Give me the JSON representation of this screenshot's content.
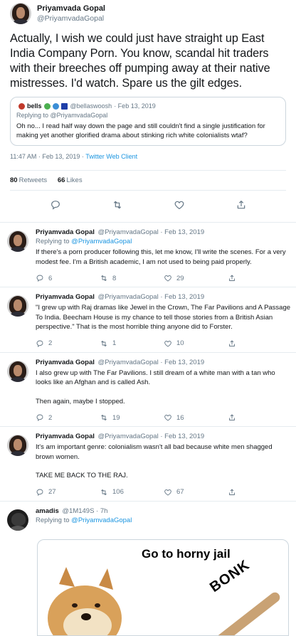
{
  "main_tweet": {
    "display_name": "Priyamvada Gopal",
    "handle": "@PriyamvadaGopal",
    "text": "Actually, I wish we could just have straight up East India Company Porn. You know, scandal hit traders with their breeches off pumping away at their native mistresses. I'd watch. Spare us the gilt edges.",
    "quote": {
      "name": "bells",
      "handle": "@bellaswoosh",
      "date": "· Feb 13, 2019",
      "replying_prefix": "Replying to",
      "replying_to": "@PriyamvadaGopal",
      "text": "Oh no... I read half way down the page and still couldn't find a single justification for making yet another glorified drama about stinking rich white colonialists wtaf?"
    },
    "timestamp": "11:47 AM · Feb 13, 2019 · ",
    "client": "Twitter Web Client",
    "retweets_count": "80",
    "retweets_label": "Retweets",
    "likes_count": "66",
    "likes_label": "Likes"
  },
  "replies": [
    {
      "name": "Priyamvada Gopal",
      "handle": "@PriyamvadaGopal · Feb 13, 2019",
      "replying_prefix": "Replying to",
      "replying_to": "@PriyamvadaGopal",
      "text": "If there's a porn producer following this, let me know, I'll write the scenes. For a very modest fee. I'm a British academic, I am not used to being paid properly.",
      "replies": "6",
      "retweets": "8",
      "likes": "29"
    },
    {
      "name": "Priyamvada Gopal",
      "handle": "@PriyamvadaGopal · Feb 13, 2019",
      "text": "\"I grew up with Raj dramas like Jewel in the Crown, The Far Pavilions and A Passage To India. Beecham House is my chance to tell those stories from a British Asian perspective.\" That is the most horrible thing anyone did to Forster.",
      "replies": "2",
      "retweets": "1",
      "likes": "10"
    },
    {
      "name": "Priyamvada Gopal",
      "handle": "@PriyamvadaGopal · Feb 13, 2019",
      "text": "I also grew up with The Far Pavilions. I still dream of a white man with a tan who looks like an Afghan and is called Ash.",
      "text2": "Then again, maybe I stopped.",
      "replies": "2",
      "retweets": "19",
      "likes": "16"
    },
    {
      "name": "Priyamvada Gopal",
      "handle": "@PriyamvadaGopal · Feb 13, 2019",
      "text": "It's am important genre: colonialism wasn't all bad because white men shagged brown women.",
      "text2": "TAKE ME BACK TO THE RAJ.",
      "replies": "27",
      "retweets": "106",
      "likes": "67"
    },
    {
      "name": "amadis",
      "handle": "@1M149S · 7h",
      "replying_prefix": "Replying to",
      "replying_to": "@PriyamvadaGopal",
      "meme_caption": "Go to horny jail",
      "meme_text": "BONK"
    }
  ],
  "colors": {
    "link": "#1b95e0",
    "muted": "#657786",
    "divider": "#e6ecf0"
  },
  "icons": [
    "reply-icon",
    "retweet-icon",
    "like-icon",
    "share-icon"
  ]
}
